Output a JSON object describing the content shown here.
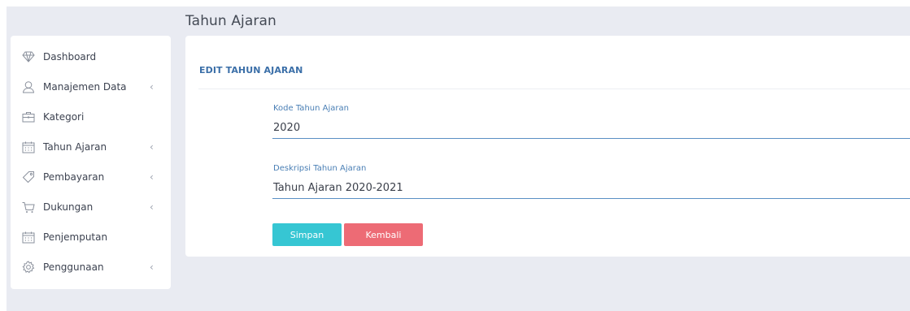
{
  "page": {
    "title": "Tahun Ajaran"
  },
  "sidebar": {
    "items": [
      {
        "label": "Dashboard",
        "icon": "diamond-icon",
        "has_submenu": false
      },
      {
        "label": "Manajemen Data",
        "icon": "user-icon",
        "has_submenu": true
      },
      {
        "label": "Kategori",
        "icon": "briefcase-icon",
        "has_submenu": false
      },
      {
        "label": "Tahun Ajaran",
        "icon": "calendar-icon",
        "has_submenu": true
      },
      {
        "label": "Pembayaran",
        "icon": "tag-icon",
        "has_submenu": true
      },
      {
        "label": "Dukungan",
        "icon": "cart-icon",
        "has_submenu": true
      },
      {
        "label": "Penjemputan",
        "icon": "calendar-icon",
        "has_submenu": false
      },
      {
        "label": "Penggunaan",
        "icon": "gear-icon",
        "has_submenu": true
      }
    ],
    "chevron": "‹"
  },
  "form": {
    "header": "EDIT TAHUN AJARAN",
    "fields": [
      {
        "label": "Kode Tahun Ajaran",
        "value": "2020"
      },
      {
        "label": "Deskripsi Tahun Ajaran",
        "value": "Tahun Ajaran 2020-2021"
      }
    ],
    "save_label": "Simpan",
    "back_label": "Kembali"
  },
  "colors": {
    "background": "#e9ebf2",
    "accent_blue": "#3b6fa8",
    "save_button": "#36c6d3",
    "back_button": "#ed6b75"
  }
}
